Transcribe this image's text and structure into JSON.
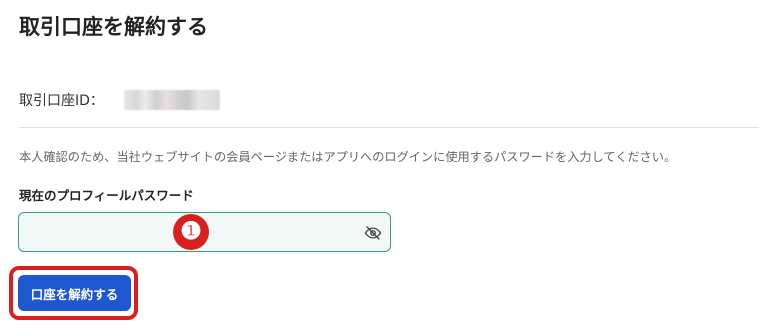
{
  "page": {
    "title": "取引口座を解約する"
  },
  "account": {
    "label": "取引口座ID：",
    "value_masked": ""
  },
  "instruction": "本人確認のため、当社ウェブサイトの会員ページまたはアプリへのログインに使用するパスワードを入力してください。",
  "password_field": {
    "label": "現在のプロフィールパスワード",
    "value": "",
    "placeholder": "",
    "toggle_icon": "eye-slash-icon"
  },
  "annotation": {
    "step_number": "❶"
  },
  "submit_button": {
    "label": "口座を解約する"
  },
  "colors": {
    "primary_button": "#1f57cf",
    "field_border": "#3e9a72",
    "field_background": "#f2f8f5",
    "annotation_red": "#d91f1f"
  }
}
